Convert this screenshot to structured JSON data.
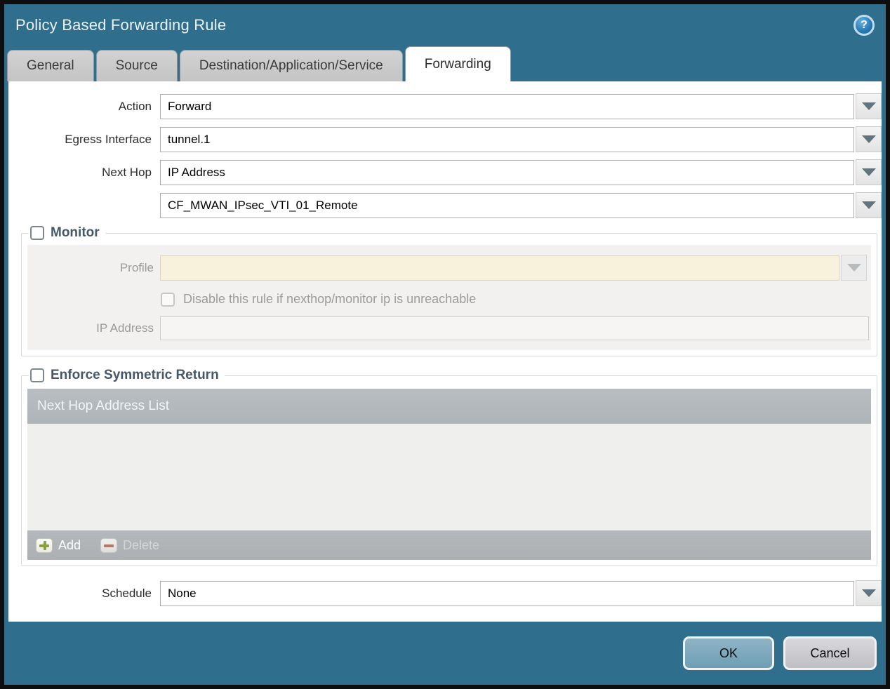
{
  "dialog": {
    "title": "Policy Based Forwarding Rule"
  },
  "icons": {
    "help_glyph": "?"
  },
  "tabs": [
    {
      "label": "General",
      "active": false
    },
    {
      "label": "Source",
      "active": false
    },
    {
      "label": "Destination/Application/Service",
      "active": false
    },
    {
      "label": "Forwarding",
      "active": true
    }
  ],
  "form": {
    "action": {
      "label": "Action",
      "value": "Forward"
    },
    "egress_interface": {
      "label": "Egress Interface",
      "value": "tunnel.1"
    },
    "next_hop": {
      "label": "Next Hop",
      "value": "IP Address"
    },
    "next_hop_address": {
      "value": "CF_MWAN_IPsec_VTI_01_Remote"
    },
    "schedule": {
      "label": "Schedule",
      "value": "None"
    }
  },
  "monitor": {
    "legend": "Monitor",
    "checked": false,
    "profile": {
      "label": "Profile",
      "value": "",
      "disabled": true
    },
    "disable_rule": {
      "label": "Disable this rule if nexthop/monitor ip is unreachable",
      "checked": false,
      "disabled": true
    },
    "ip_address": {
      "label": "IP Address",
      "value": "",
      "disabled": true
    }
  },
  "symmetric_return": {
    "legend": "Enforce Symmetric Return",
    "checked": false,
    "table": {
      "header": "Next Hop Address List",
      "rows": []
    },
    "buttons": {
      "add": "Add",
      "delete": "Delete",
      "delete_disabled": true
    }
  },
  "footer": {
    "ok": "OK",
    "cancel": "Cancel"
  },
  "colors": {
    "titlebar_teal": "#2F6E8D",
    "tab_gray": "#C9C9C9",
    "active_tab_white": "#FFFFFF",
    "disabled_field_cream": "#F8F1DC",
    "table_header_gray": "#B3B8BC",
    "add_plus_green": "#8A9F3E",
    "delete_minus_red": "#B5786B",
    "ok_button_blue": "#7BA6BB",
    "cancel_button_gray": "#C9CACD"
  }
}
